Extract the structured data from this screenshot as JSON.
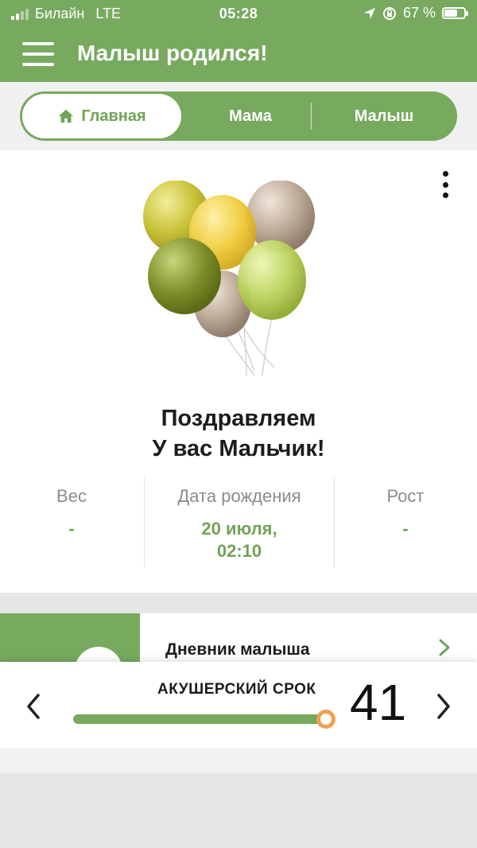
{
  "status_bar": {
    "carrier": "Билайн",
    "network": "LTE",
    "time": "05:28",
    "battery_percent": "67 %",
    "battery_level": 0.67
  },
  "header": {
    "title": "Малыш родился!"
  },
  "tabs": [
    {
      "label": "Главная",
      "active": true
    },
    {
      "label": "Мама",
      "active": false
    },
    {
      "label": "Малыш",
      "active": false
    }
  ],
  "card": {
    "congrats_line1": "Поздравляем",
    "congrats_line2": "У вас Мальчик!",
    "stats": [
      {
        "label": "Вес",
        "value": "-"
      },
      {
        "label": "Дата рождения",
        "value_line1": "20 июля,",
        "value_line2": "02:10"
      },
      {
        "label": "Рост",
        "value": "-"
      }
    ]
  },
  "diary": {
    "title": "Дневник малыша"
  },
  "term": {
    "label": "АКУШЕРСКИЙ СРОК",
    "week": "41"
  },
  "colors": {
    "brand_green": "#77a95f",
    "accent_green_text": "#6fa457",
    "slider_knob": "#f0a053"
  },
  "icons": [
    "signal-icon",
    "location-icon",
    "rotation-lock-icon",
    "battery-icon",
    "menu-icon",
    "home-icon",
    "more-vert-icon",
    "chevron-right-icon",
    "chevron-left-icon"
  ]
}
